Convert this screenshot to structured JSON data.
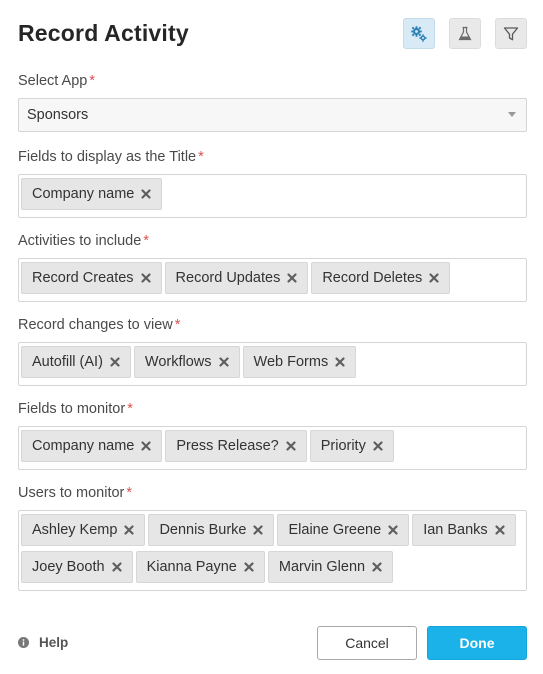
{
  "dialog": {
    "title": "Record Activity",
    "header_icons": [
      "gears-icon",
      "flask-icon",
      "filter-icon"
    ]
  },
  "fields": {
    "select_app": {
      "label": "Select App",
      "value": "Sponsors"
    },
    "title_fields": {
      "label": "Fields to display as the Title",
      "tags": [
        "Company name"
      ]
    },
    "activities": {
      "label": "Activities to include",
      "tags": [
        "Record Creates",
        "Record Updates",
        "Record Deletes"
      ]
    },
    "record_changes": {
      "label": "Record changes to view",
      "tags": [
        "Autofill (AI)",
        "Workflows",
        "Web Forms"
      ]
    },
    "fields_monitor": {
      "label": "Fields to monitor",
      "tags": [
        "Company name",
        "Press Release?",
        "Priority"
      ]
    },
    "users_monitor": {
      "label": "Users to monitor",
      "tags": [
        "Ashley Kemp",
        "Dennis Burke",
        "Elaine Greene",
        "Ian Banks",
        "Joey Booth",
        "Kianna Payne",
        "Marvin Glenn"
      ]
    }
  },
  "required_marker": "*",
  "footer": {
    "help_label": "Help",
    "cancel_label": "Cancel",
    "done_label": "Done"
  },
  "colors": {
    "accent": "#1ab2e8",
    "required": "#d9534f",
    "active_header_button": "#d7eaf5"
  }
}
